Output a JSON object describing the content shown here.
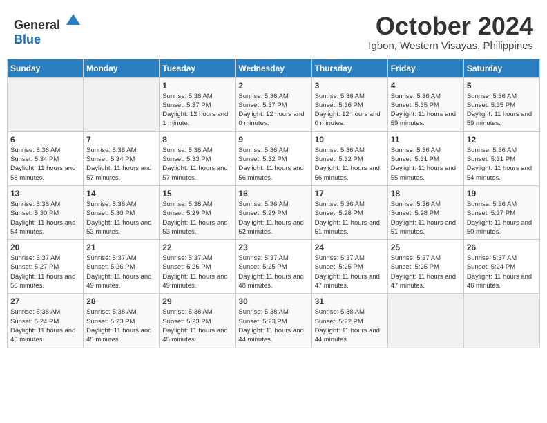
{
  "header": {
    "logo_general": "General",
    "logo_blue": "Blue",
    "month": "October 2024",
    "location": "Igbon, Western Visayas, Philippines"
  },
  "days_of_week": [
    "Sunday",
    "Monday",
    "Tuesday",
    "Wednesday",
    "Thursday",
    "Friday",
    "Saturday"
  ],
  "weeks": [
    [
      {
        "day": "",
        "empty": true
      },
      {
        "day": "",
        "empty": true
      },
      {
        "day": "1",
        "sunrise": "5:36 AM",
        "sunset": "5:37 PM",
        "daylight": "12 hours and 1 minute."
      },
      {
        "day": "2",
        "sunrise": "5:36 AM",
        "sunset": "5:37 PM",
        "daylight": "12 hours and 0 minutes."
      },
      {
        "day": "3",
        "sunrise": "5:36 AM",
        "sunset": "5:36 PM",
        "daylight": "12 hours and 0 minutes."
      },
      {
        "day": "4",
        "sunrise": "5:36 AM",
        "sunset": "5:35 PM",
        "daylight": "11 hours and 59 minutes."
      },
      {
        "day": "5",
        "sunrise": "5:36 AM",
        "sunset": "5:35 PM",
        "daylight": "11 hours and 59 minutes."
      }
    ],
    [
      {
        "day": "6",
        "sunrise": "5:36 AM",
        "sunset": "5:34 PM",
        "daylight": "11 hours and 58 minutes."
      },
      {
        "day": "7",
        "sunrise": "5:36 AM",
        "sunset": "5:34 PM",
        "daylight": "11 hours and 57 minutes."
      },
      {
        "day": "8",
        "sunrise": "5:36 AM",
        "sunset": "5:33 PM",
        "daylight": "11 hours and 57 minutes."
      },
      {
        "day": "9",
        "sunrise": "5:36 AM",
        "sunset": "5:32 PM",
        "daylight": "11 hours and 56 minutes."
      },
      {
        "day": "10",
        "sunrise": "5:36 AM",
        "sunset": "5:32 PM",
        "daylight": "11 hours and 56 minutes."
      },
      {
        "day": "11",
        "sunrise": "5:36 AM",
        "sunset": "5:31 PM",
        "daylight": "11 hours and 55 minutes."
      },
      {
        "day": "12",
        "sunrise": "5:36 AM",
        "sunset": "5:31 PM",
        "daylight": "11 hours and 54 minutes."
      }
    ],
    [
      {
        "day": "13",
        "sunrise": "5:36 AM",
        "sunset": "5:30 PM",
        "daylight": "11 hours and 54 minutes."
      },
      {
        "day": "14",
        "sunrise": "5:36 AM",
        "sunset": "5:30 PM",
        "daylight": "11 hours and 53 minutes."
      },
      {
        "day": "15",
        "sunrise": "5:36 AM",
        "sunset": "5:29 PM",
        "daylight": "11 hours and 53 minutes."
      },
      {
        "day": "16",
        "sunrise": "5:36 AM",
        "sunset": "5:29 PM",
        "daylight": "11 hours and 52 minutes."
      },
      {
        "day": "17",
        "sunrise": "5:36 AM",
        "sunset": "5:28 PM",
        "daylight": "11 hours and 51 minutes."
      },
      {
        "day": "18",
        "sunrise": "5:36 AM",
        "sunset": "5:28 PM",
        "daylight": "11 hours and 51 minutes."
      },
      {
        "day": "19",
        "sunrise": "5:36 AM",
        "sunset": "5:27 PM",
        "daylight": "11 hours and 50 minutes."
      }
    ],
    [
      {
        "day": "20",
        "sunrise": "5:37 AM",
        "sunset": "5:27 PM",
        "daylight": "11 hours and 50 minutes."
      },
      {
        "day": "21",
        "sunrise": "5:37 AM",
        "sunset": "5:26 PM",
        "daylight": "11 hours and 49 minutes."
      },
      {
        "day": "22",
        "sunrise": "5:37 AM",
        "sunset": "5:26 PM",
        "daylight": "11 hours and 49 minutes."
      },
      {
        "day": "23",
        "sunrise": "5:37 AM",
        "sunset": "5:25 PM",
        "daylight": "11 hours and 48 minutes."
      },
      {
        "day": "24",
        "sunrise": "5:37 AM",
        "sunset": "5:25 PM",
        "daylight": "11 hours and 47 minutes."
      },
      {
        "day": "25",
        "sunrise": "5:37 AM",
        "sunset": "5:25 PM",
        "daylight": "11 hours and 47 minutes."
      },
      {
        "day": "26",
        "sunrise": "5:37 AM",
        "sunset": "5:24 PM",
        "daylight": "11 hours and 46 minutes."
      }
    ],
    [
      {
        "day": "27",
        "sunrise": "5:38 AM",
        "sunset": "5:24 PM",
        "daylight": "11 hours and 46 minutes."
      },
      {
        "day": "28",
        "sunrise": "5:38 AM",
        "sunset": "5:23 PM",
        "daylight": "11 hours and 45 minutes."
      },
      {
        "day": "29",
        "sunrise": "5:38 AM",
        "sunset": "5:23 PM",
        "daylight": "11 hours and 45 minutes."
      },
      {
        "day": "30",
        "sunrise": "5:38 AM",
        "sunset": "5:23 PM",
        "daylight": "11 hours and 44 minutes."
      },
      {
        "day": "31",
        "sunrise": "5:38 AM",
        "sunset": "5:22 PM",
        "daylight": "11 hours and 44 minutes."
      },
      {
        "day": "",
        "empty": true
      },
      {
        "day": "",
        "empty": true
      }
    ]
  ]
}
